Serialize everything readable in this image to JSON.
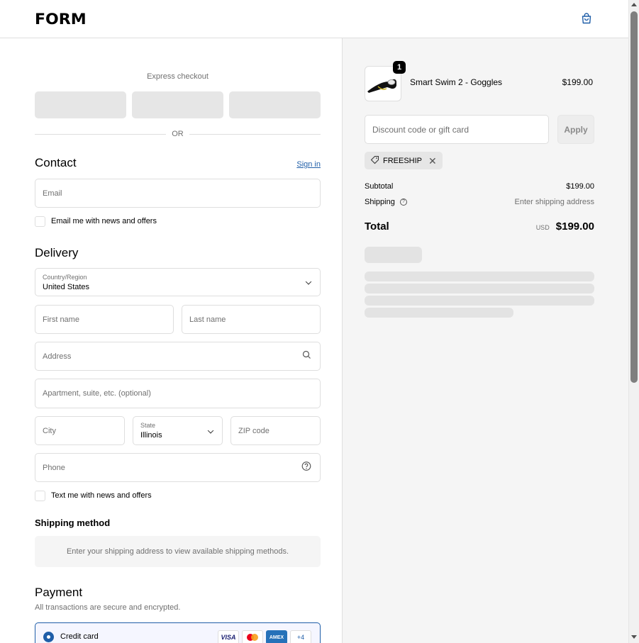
{
  "header": {
    "logo": "FORM",
    "cart_icon": "shopping-bag-icon"
  },
  "express": {
    "title": "Express checkout",
    "divider": "OR"
  },
  "contact": {
    "heading": "Contact",
    "sign_in": "Sign in",
    "email_placeholder": "Email",
    "newsletter_label": "Email me with news and offers"
  },
  "delivery": {
    "heading": "Delivery",
    "country_label": "Country/Region",
    "country_value": "United States",
    "first_name": "First name",
    "last_name": "Last name",
    "address": "Address",
    "apartment": "Apartment, suite, etc. (optional)",
    "city": "City",
    "state_label": "State",
    "state_value": "Illinois",
    "zip": "ZIP code",
    "phone": "Phone",
    "sms_label": "Text me with news and offers"
  },
  "shipping": {
    "heading": "Shipping method",
    "message": "Enter your shipping address to view available shipping methods."
  },
  "payment": {
    "heading": "Payment",
    "subtitle": "All transactions are secure and encrypted.",
    "method": "Credit card",
    "cards": [
      "VISA",
      "mastercard",
      "AMEX",
      "+4"
    ]
  },
  "summary": {
    "product_name": "Smart Swim 2 - Goggles",
    "product_price": "$199.00",
    "quantity": "1",
    "discount_placeholder": "Discount code or gift card",
    "apply": "Apply",
    "discount_tag": "FREESHIP",
    "subtotal_label": "Subtotal",
    "subtotal_value": "$199.00",
    "shipping_label": "Shipping",
    "shipping_value": "Enter shipping address",
    "total_label": "Total",
    "total_currency": "USD",
    "total_value": "$199.00"
  },
  "colors": {
    "accent": "#1f5ea8",
    "panel": "#f5f5f5"
  }
}
